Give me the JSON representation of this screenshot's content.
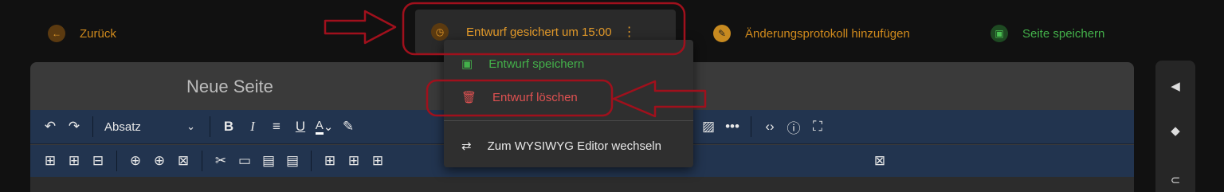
{
  "topbar": {
    "back": {
      "label": "Zurück",
      "icon": "arrow-left-icon"
    },
    "draft": {
      "label": "Entwurf gesichert um 15:00",
      "icon": "clock-icon",
      "more": "⋮"
    },
    "changelog": {
      "label": "Änderungsprotokoll hinzufügen",
      "icon": "pencil-icon"
    },
    "save_page": {
      "label": "Seite speichern",
      "icon": "floppy-icon"
    }
  },
  "editor": {
    "title_placeholder": "Neue Seite",
    "block_format": "Absatz"
  },
  "draft_menu": {
    "items": [
      {
        "label": "Entwurf speichern",
        "icon": "floppy-icon"
      },
      {
        "label": "Entwurf löschen",
        "icon": "trash-icon"
      },
      {
        "label": "Zum WYSIWYG Editor wechseln",
        "icon": "swap-icon"
      }
    ]
  },
  "colors": {
    "accent_orange": "#e39a2a",
    "save_green": "#43b04a",
    "delete_red": "#e05151",
    "annotation_red": "#a0101c",
    "toolbar_blue": "#22344f"
  }
}
